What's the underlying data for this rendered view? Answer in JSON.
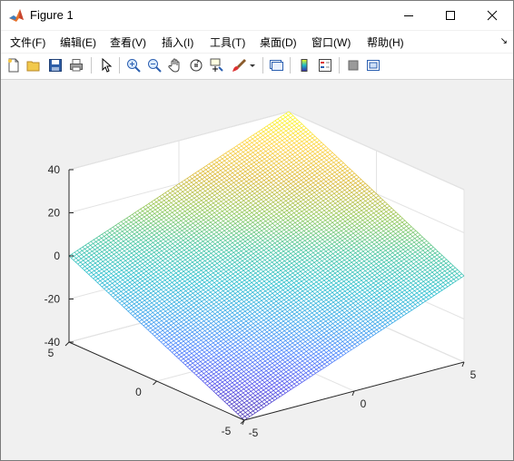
{
  "window": {
    "title": "Figure 1",
    "minimize_icon": "minimize-icon",
    "maximize_icon": "maximize-icon",
    "close_icon": "close-icon"
  },
  "menu": {
    "items": [
      "文件(F)",
      "编辑(E)",
      "查看(V)",
      "插入(I)",
      "工具(T)",
      "桌面(D)",
      "窗口(W)",
      "帮助(H)"
    ]
  },
  "toolbar": {
    "icons": [
      "new-figure-icon",
      "open-file-icon",
      "save-icon",
      "print-icon",
      "pointer-icon",
      "zoom-in-icon",
      "zoom-out-icon",
      "pan-icon",
      "rotate-3d-icon",
      "data-cursor-icon",
      "brush-icon",
      "brush-dropdown-icon",
      "link-plot-icon",
      "colorbar-icon",
      "legend-icon",
      "hide-plot-tools-icon",
      "show-plot-tools-icon"
    ]
  },
  "chart_data": {
    "type": "surface",
    "title": "",
    "xlabel": "",
    "ylabel": "",
    "zlabel": "",
    "x_ticks": [
      "-5",
      "0",
      "5"
    ],
    "y_ticks": [
      "-5",
      "0",
      "5"
    ],
    "z_ticks": [
      "-40",
      "-20",
      "0",
      "20",
      "40"
    ],
    "xlim": [
      -5,
      5
    ],
    "ylim": [
      -5,
      5
    ],
    "zlim": [
      -40,
      40
    ],
    "grid": true,
    "colormap": [
      "#3e26a8",
      "#4746eb",
      "#3e7bfc",
      "#2ca2e8",
      "#1bbac9",
      "#3ac199",
      "#8bc44f",
      "#d8b42c",
      "#fdce37",
      "#f9fb15"
    ],
    "surface": {
      "description_equation": "z = f(x, y)",
      "corners": [
        {
          "x": -5,
          "y": -5,
          "z": -40
        },
        {
          "x": 5,
          "y": -5,
          "z": 0
        },
        {
          "x": 5,
          "y": 5,
          "z": 40
        },
        {
          "x": -5,
          "y": 5,
          "z": 0
        }
      ],
      "mesh_lines": 80
    }
  }
}
